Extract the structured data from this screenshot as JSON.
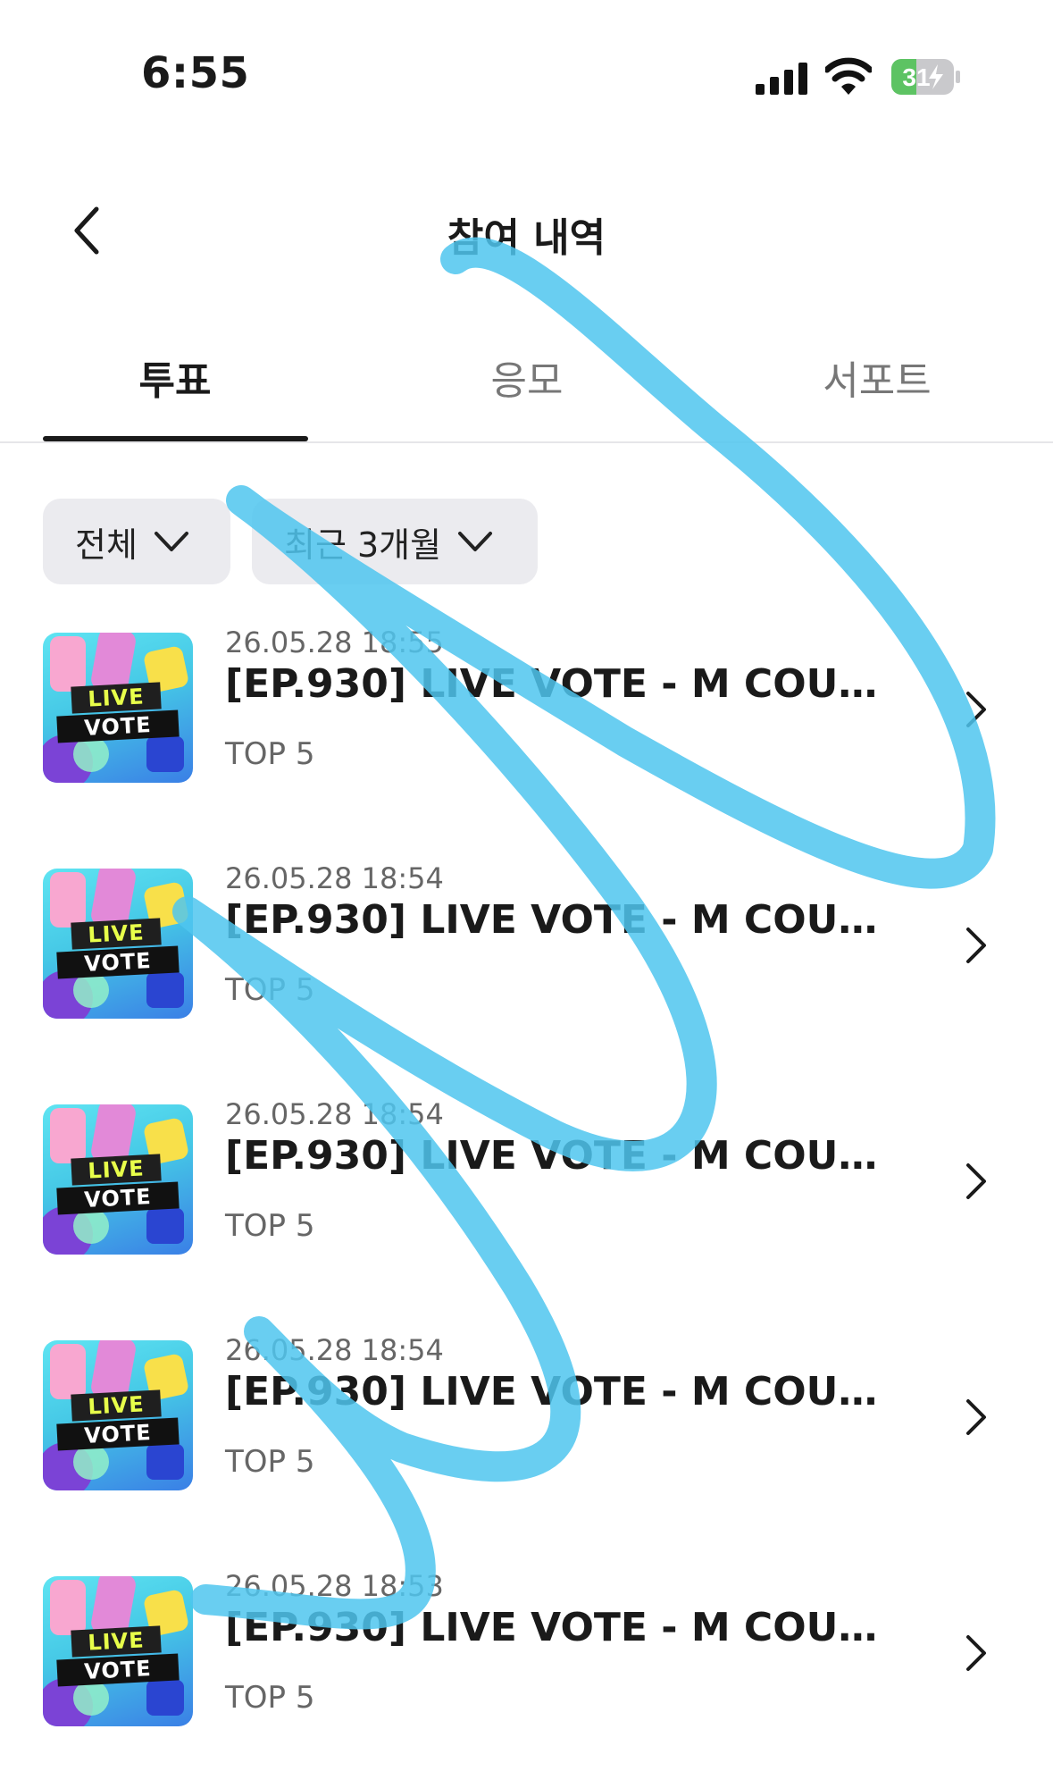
{
  "status_bar": {
    "time": "6:55",
    "battery": "31"
  },
  "header": {
    "title": "참여 내역"
  },
  "tabs": [
    {
      "label": "투표",
      "active": true
    },
    {
      "label": "응모",
      "active": false
    },
    {
      "label": "서포트",
      "active": false
    }
  ],
  "filters": [
    {
      "label": "전체"
    },
    {
      "label": "최근 3개월"
    }
  ],
  "thumbnail_text": {
    "line1": "LIVE",
    "line2": "VOTE"
  },
  "items": [
    {
      "date": "26.05.28 18:55",
      "title": "[EP.930] LIVE VOTE - M COUNT...",
      "sub": "TOP 5"
    },
    {
      "date": "26.05.28 18:54",
      "title": "[EP.930] LIVE VOTE - M COUNT...",
      "sub": "TOP 5"
    },
    {
      "date": "26.05.28 18:54",
      "title": "[EP.930] LIVE VOTE - M COUNT...",
      "sub": "TOP 5"
    },
    {
      "date": "26.05.28 18:54",
      "title": "[EP.930] LIVE VOTE - M COUNT...",
      "sub": "TOP 5"
    },
    {
      "date": "26.05.28 18:53",
      "title": "[EP.930] LIVE VOTE - M COUNT...",
      "sub": "TOP 5"
    }
  ],
  "colors": {
    "accent_text": "#1a1a1a",
    "chip_bg": "#ebebef",
    "battery_green": "#5dc363",
    "annotation_stroke": "#4fc6ee"
  }
}
